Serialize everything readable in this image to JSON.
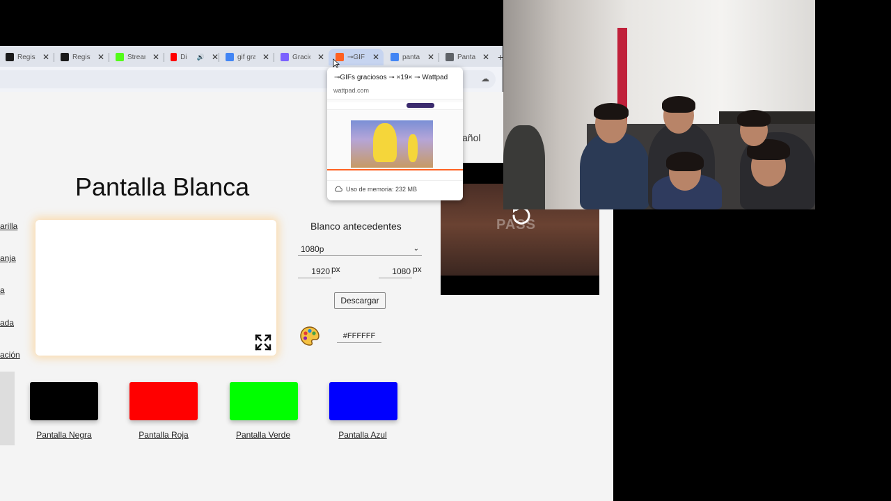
{
  "browser": {
    "tabs": [
      {
        "label": "Regist",
        "favicon_color": "#1a1a1a",
        "active": false
      },
      {
        "label": "Regist",
        "favicon_color": "#1a1a1a",
        "active": false
      },
      {
        "label": "Stream",
        "favicon_color": "#53fc18",
        "active": false
      },
      {
        "label": "Di",
        "favicon_color": "#ff0000",
        "active": false,
        "speaker": "🔊"
      },
      {
        "label": "gif gra",
        "favicon_color": "#4285f4",
        "active": false
      },
      {
        "label": "Gracio",
        "favicon_color": "#7b61ff",
        "active": false
      },
      {
        "label": "⊸GIF",
        "favicon_color": "#ff6122",
        "active": true
      },
      {
        "label": "panta",
        "favicon_color": "#4285f4",
        "active": false
      },
      {
        "label": "Panta",
        "favicon_color": "#5f6368",
        "active": false
      }
    ],
    "close_glyph": "✕",
    "new_tab_glyph": "+",
    "accent": "#c6d4f0"
  },
  "hover_card": {
    "title": "⊸GIFs graciosos ⊸ ×19× ⊸ Wattpad",
    "url": "wattpad.com",
    "memory": "Uso de memoria: 232 MB"
  },
  "page": {
    "title": "Pantalla Blanca",
    "lang_fragment": "añol",
    "side_links": [
      "arilla",
      "anja",
      "a",
      "ada",
      "ación"
    ],
    "settings_title": "Blanco antecedentes",
    "resolution": "1080p",
    "width_value": "1920",
    "height_value": "1080",
    "px_unit": "px",
    "download_label": "Descargar",
    "color_value": "#FFFFFF",
    "swatches": [
      {
        "label": "Pantalla Negra",
        "color": "#000000"
      },
      {
        "label": "Pantalla Roja",
        "color": "#ff0000"
      },
      {
        "label": "Pantalla Verde",
        "color": "#00ff00"
      },
      {
        "label": "Pantalla Azul",
        "color": "#0000ff"
      }
    ]
  },
  "video": {
    "logo_text": "PASS"
  }
}
